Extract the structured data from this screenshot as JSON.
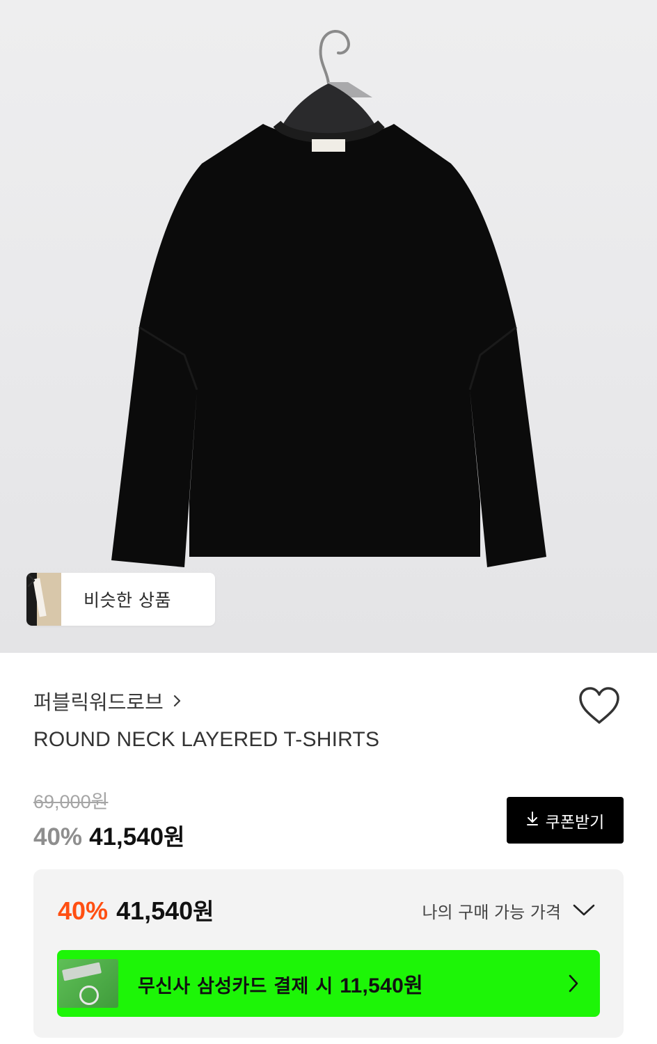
{
  "hero": {
    "product_image": "black layered long-sleeve t-shirt on hanger",
    "similar_button_label": "비슷한 상품"
  },
  "product": {
    "brand": "퍼블릭워드로브",
    "title": "ROUND NECK LAYERED T-SHIRTS",
    "original_price": "69,000원",
    "discount_rate": "40%",
    "sale_price": "41,540",
    "currency": "원",
    "liked": false
  },
  "coupon": {
    "label": "쿠폰받기",
    "icon": "download-icon"
  },
  "my_price": {
    "discount_rate": "40%",
    "price": "41,540",
    "currency": "원",
    "toggle_label": "나의 구매 가능 가격",
    "expanded": false
  },
  "card_promo": {
    "text": "무신사 삼성카드 결제 시 ",
    "amount": "11,540원",
    "background": "#1DF507"
  },
  "colors": {
    "discount_orange": "#FF4F12",
    "discount_gray": "#8E8E8E",
    "coupon_bg": "#000000"
  }
}
